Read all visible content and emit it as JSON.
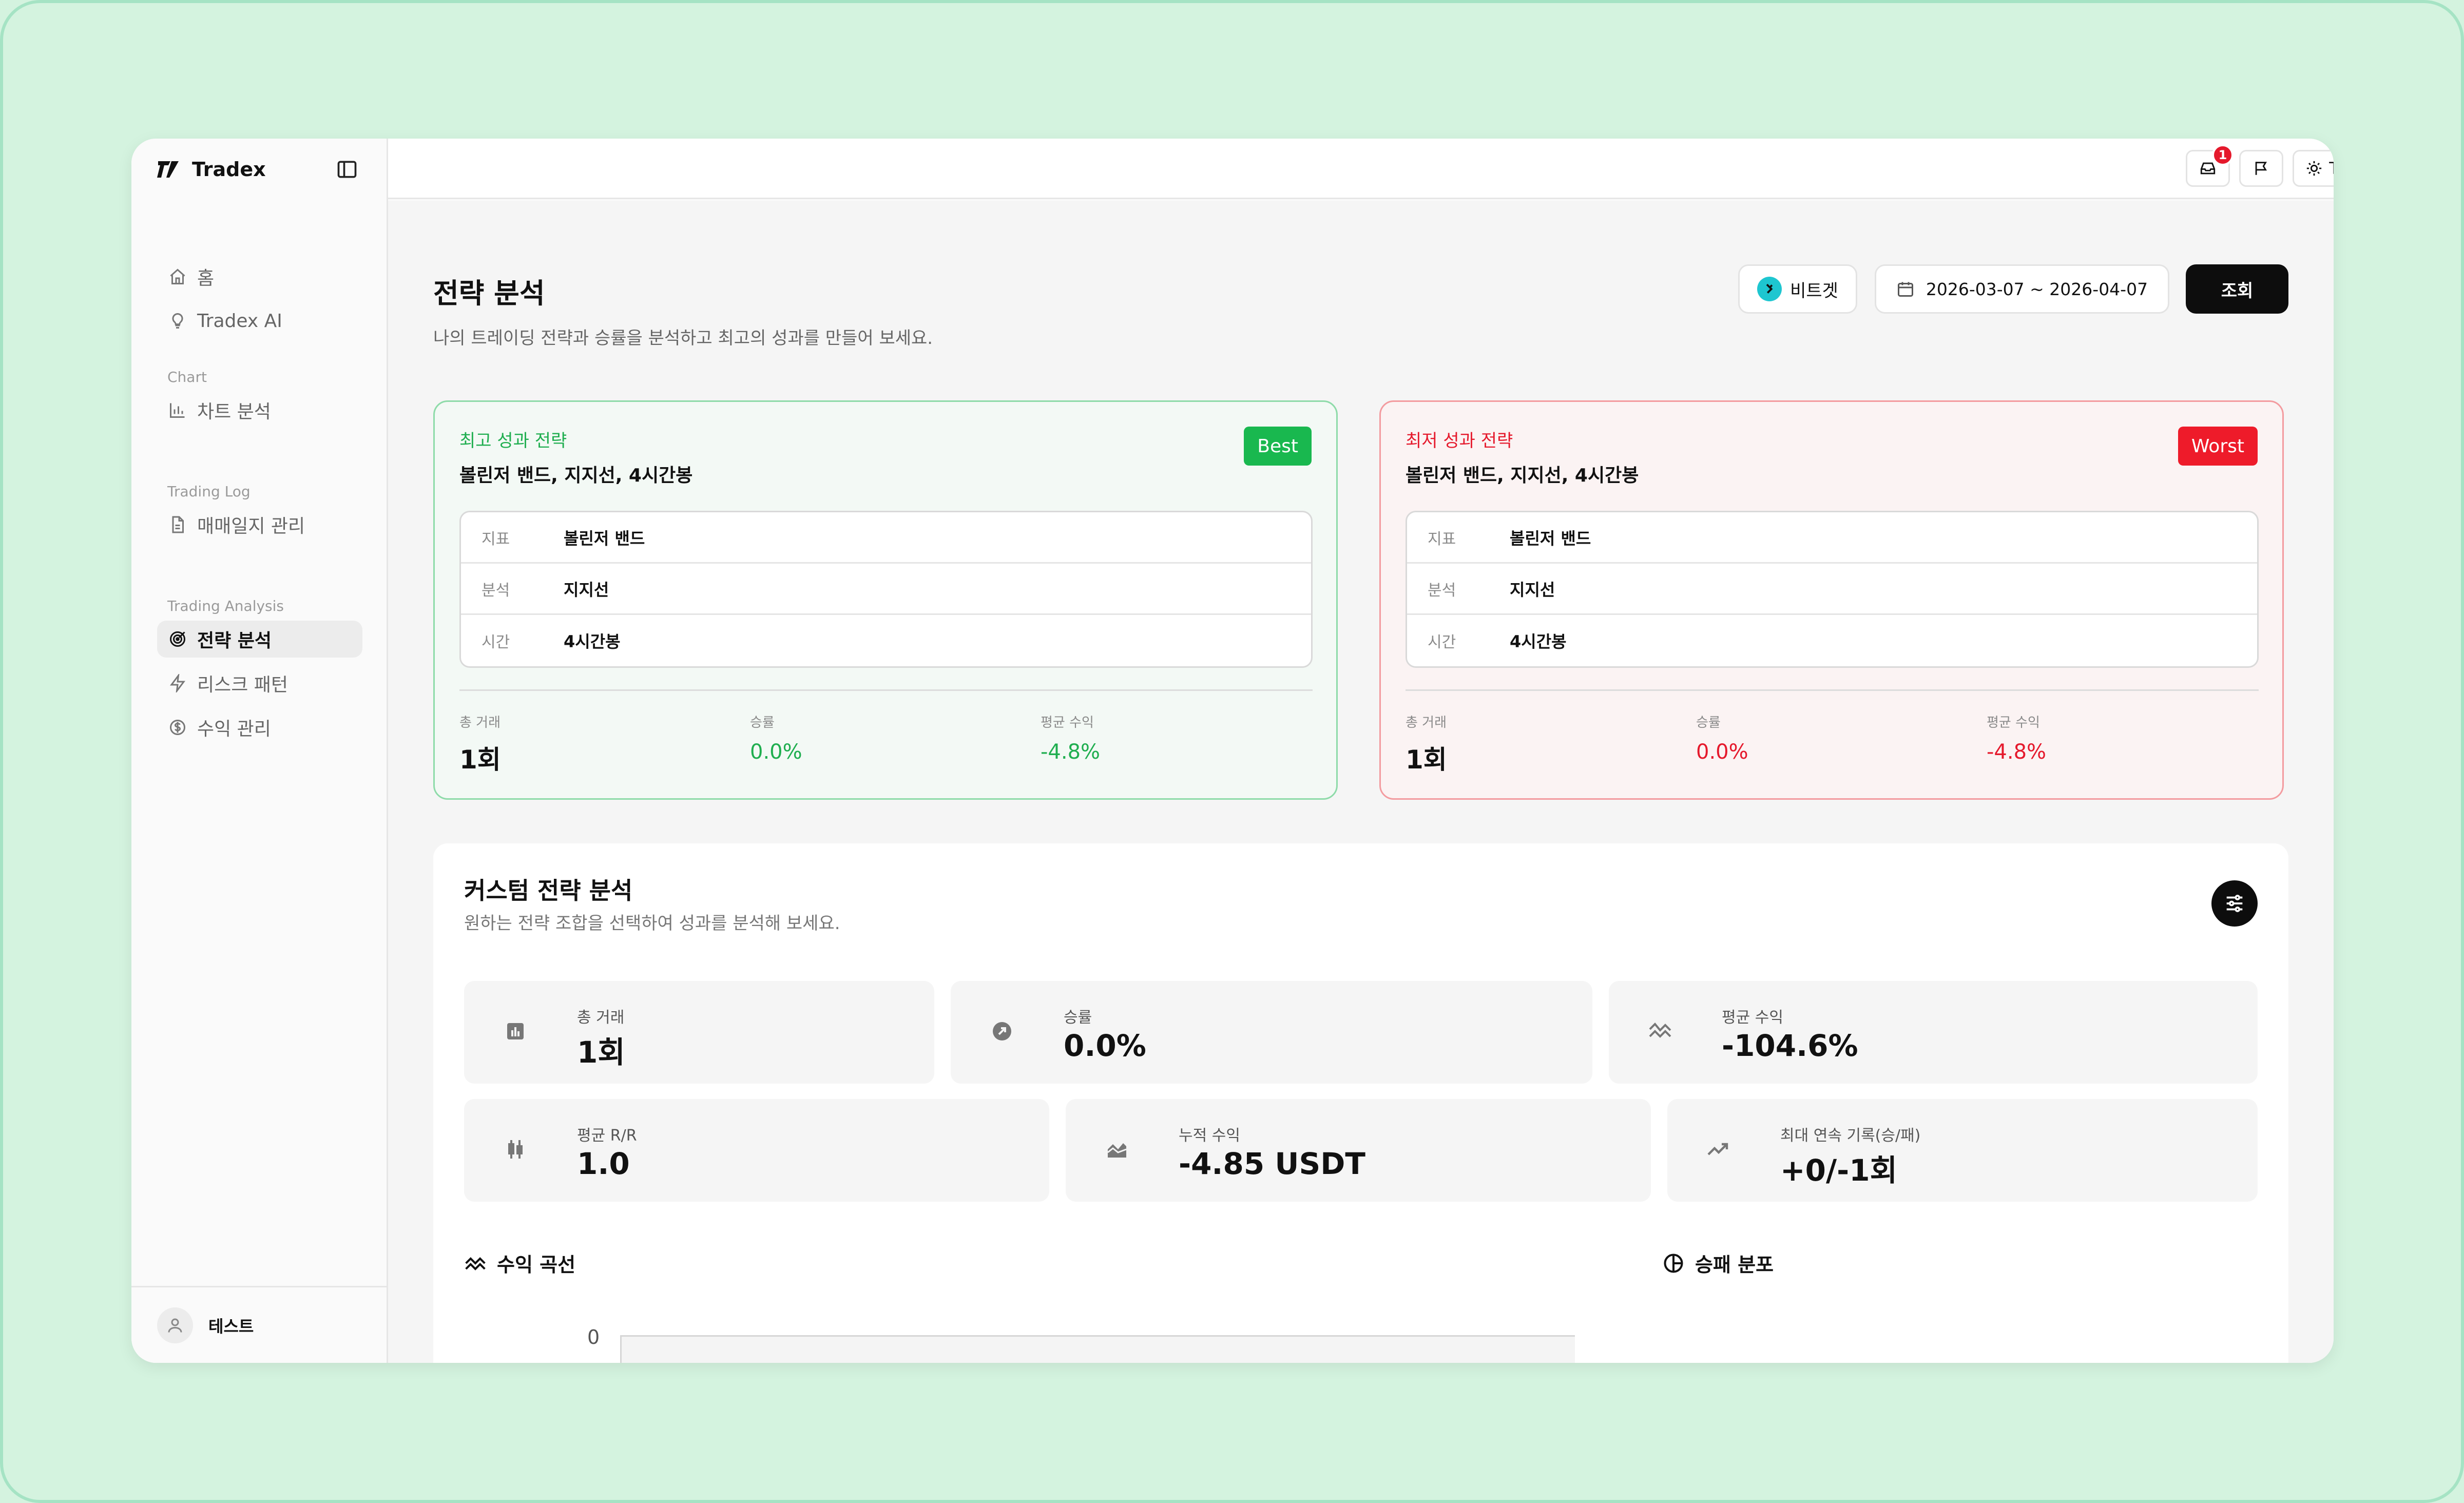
{
  "app": {
    "name": "Tradex"
  },
  "sidebar": {
    "items_top": [
      {
        "label": "홈"
      },
      {
        "label": "Tradex AI"
      }
    ],
    "sections": [
      {
        "title": "Chart",
        "items": [
          {
            "label": "차트 분석"
          }
        ]
      },
      {
        "title": "Trading Log",
        "items": [
          {
            "label": "매매일지 관리"
          }
        ]
      },
      {
        "title": "Trading Analysis",
        "items": [
          {
            "label": "전략 분석",
            "active": true
          },
          {
            "label": "리스크 패턴"
          },
          {
            "label": "수익 관리"
          }
        ]
      }
    ],
    "user": {
      "name": "테스트"
    }
  },
  "topbar": {
    "notification_count": "1",
    "ai_button_label": "Tradex AI"
  },
  "page": {
    "title": "전략 분석",
    "subtitle": "나의 트레이딩 전략과 승률을 분석하고 최고의 성과를 만들어 보세요.",
    "exchange_label": "비트겟",
    "date_range": "2026-03-07 ~ 2026-04-07",
    "query_label": "조회"
  },
  "best": {
    "label": "최고 성과 전략",
    "title": "볼린저 밴드, 지지선, 4시간봉",
    "tag": "Best",
    "rows": [
      {
        "k": "지표",
        "v": "볼린저 밴드"
      },
      {
        "k": "분석",
        "v": "지지선"
      },
      {
        "k": "시간",
        "v": "4시간봉"
      }
    ],
    "stats": {
      "total_label": "총 거래",
      "total_value": "1회",
      "winrate_label": "승률",
      "winrate_value": "0.0%",
      "avg_label": "평균 수익",
      "avg_value": "-4.8%"
    }
  },
  "worst": {
    "label": "최저 성과 전략",
    "title": "볼린저 밴드, 지지선, 4시간봉",
    "tag": "Worst",
    "rows": [
      {
        "k": "지표",
        "v": "볼린저 밴드"
      },
      {
        "k": "분석",
        "v": "지지선"
      },
      {
        "k": "시간",
        "v": "4시간봉"
      }
    ],
    "stats": {
      "total_label": "총 거래",
      "total_value": "1회",
      "winrate_label": "승률",
      "winrate_value": "0.0%",
      "avg_label": "평균 수익",
      "avg_value": "-4.8%"
    }
  },
  "custom": {
    "title": "커스텀 전략 분석",
    "subtitle": "원하는 전략 조합을 선택하여 성과를 분석해 보세요.",
    "stats": [
      {
        "label": "총 거래",
        "value": "1회",
        "icon": "bar-chart-icon"
      },
      {
        "label": "승률",
        "value": "0.0%",
        "icon": "compass-arrow-icon"
      },
      {
        "label": "평균 수익",
        "value": "-104.6%",
        "icon": "trend-down-icon"
      },
      {
        "label": "평균 R/R",
        "value": "1.0",
        "icon": "candlestick-icon"
      },
      {
        "label": "누적 수익",
        "value": "-4.85 USDT",
        "icon": "area-chart-icon"
      },
      {
        "label": "최대 연속 기록(승/패)",
        "value": "+0/-1회",
        "icon": "trend-line-icon"
      }
    ],
    "profit_curve_title": "수익 곡선",
    "win_loss_title": "승패 분포",
    "chart_tick": "0"
  },
  "colors": {
    "positive": "#1fae4f",
    "negative": "#e5192c",
    "accent_dark": "#0d0d0d"
  }
}
